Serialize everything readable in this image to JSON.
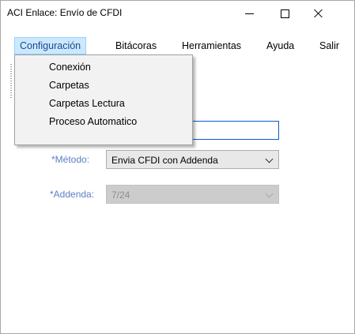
{
  "window": {
    "title": "ACI Enlace: Envío de CFDI"
  },
  "menubar": {
    "items": [
      "Configuración",
      "Bitácoras",
      "Herramientas",
      "Ayuda",
      "Salir"
    ]
  },
  "config_menu": {
    "items": [
      "Conexión",
      "Carpetas",
      "Carpetas Lectura",
      "Proceso Automatico"
    ]
  },
  "form": {
    "metodo_label": "*Método:",
    "metodo_value": "Envia CFDI con Addenda",
    "addenda_label": "*Addenda:",
    "addenda_value": "7/24"
  },
  "colors": {
    "label": "#5b7fc4",
    "menu_highlight": "#cce8ff",
    "input_focus_border": "#0a5ad3"
  }
}
